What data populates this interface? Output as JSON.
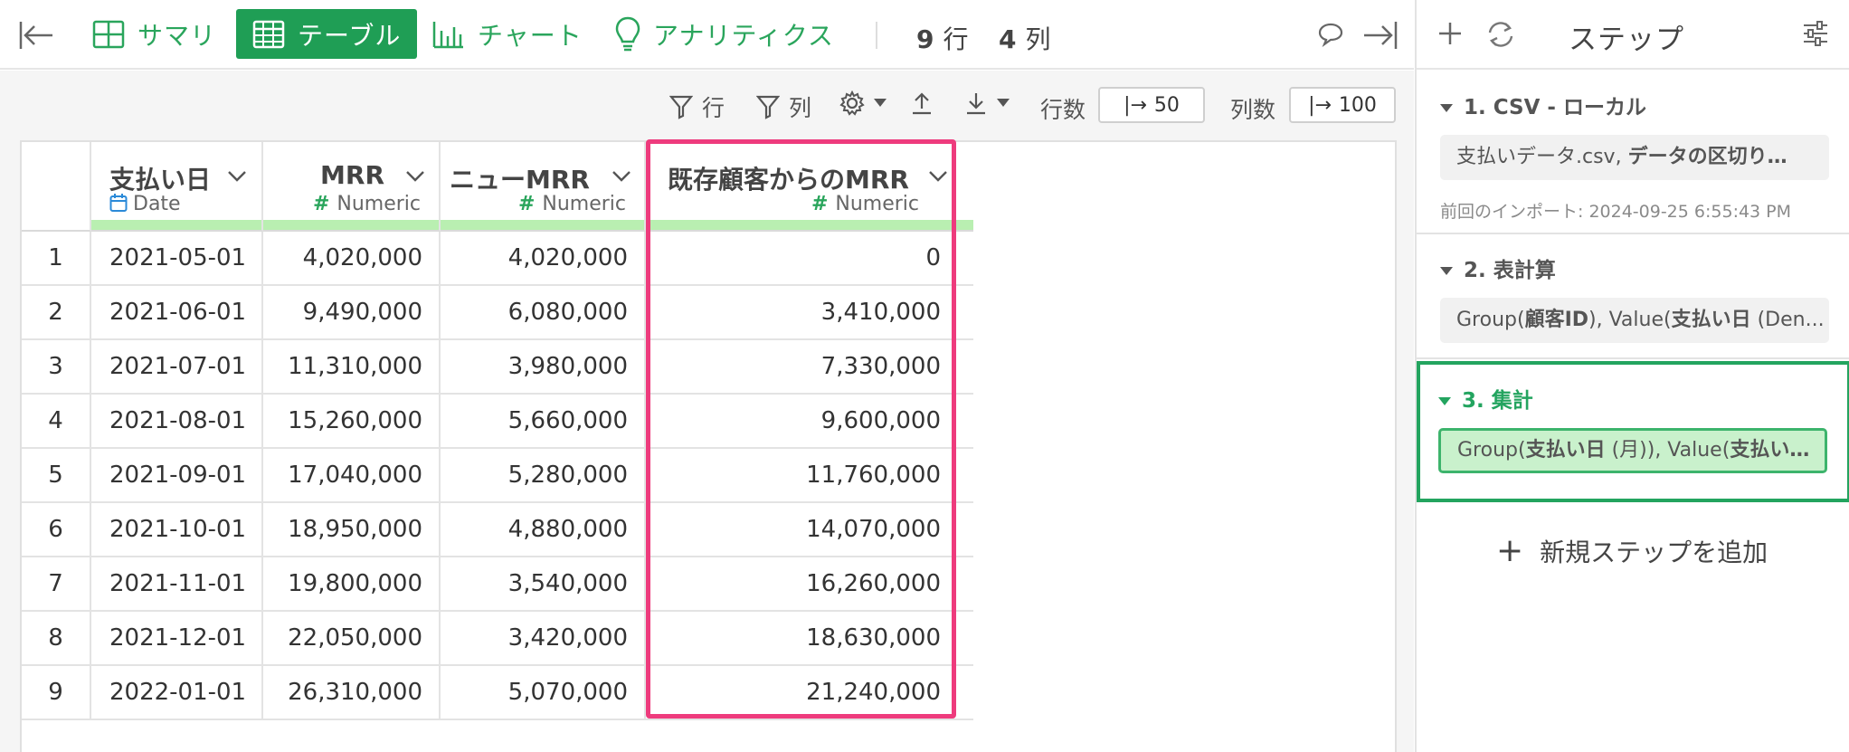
{
  "toolbar": {
    "tabs": [
      {
        "label": "サマリ",
        "icon": "summary-grid-icon"
      },
      {
        "label": "テーブル",
        "icon": "table-icon",
        "active": true
      },
      {
        "label": "チャート",
        "icon": "bar-chart-icon"
      },
      {
        "label": "アナリティクス",
        "icon": "lightbulb-icon"
      }
    ],
    "rows_count": "9",
    "rows_unit": "行",
    "cols_count": "4",
    "cols_unit": "列"
  },
  "subbar": {
    "row_filter": "行",
    "col_filter": "列",
    "row_count_label": "行数",
    "row_count_value": "50",
    "col_count_label": "列数",
    "col_count_value": "100"
  },
  "table": {
    "columns": [
      {
        "name": "支払い日",
        "type": "Date"
      },
      {
        "name": "MRR",
        "type": "Numeric"
      },
      {
        "name": "ニューMRR",
        "type": "Numeric"
      },
      {
        "name": "既存顧客からのMRR",
        "type": "Numeric"
      }
    ],
    "rows": [
      [
        "1",
        "2021-05-01",
        "4,020,000",
        "4,020,000",
        "0"
      ],
      [
        "2",
        "2021-06-01",
        "9,490,000",
        "6,080,000",
        "3,410,000"
      ],
      [
        "3",
        "2021-07-01",
        "11,310,000",
        "3,980,000",
        "7,330,000"
      ],
      [
        "4",
        "2021-08-01",
        "15,260,000",
        "5,660,000",
        "9,600,000"
      ],
      [
        "5",
        "2021-09-01",
        "17,040,000",
        "5,280,000",
        "11,760,000"
      ],
      [
        "6",
        "2021-10-01",
        "18,950,000",
        "4,880,000",
        "14,070,000"
      ],
      [
        "7",
        "2021-11-01",
        "19,800,000",
        "3,540,000",
        "16,260,000"
      ],
      [
        "8",
        "2021-12-01",
        "22,050,000",
        "3,420,000",
        "18,630,000"
      ],
      [
        "9",
        "2022-01-01",
        "26,310,000",
        "5,070,000",
        "21,240,000"
      ]
    ]
  },
  "panel": {
    "title": "ステップ",
    "steps": [
      {
        "title": "1. CSV - ローカル",
        "summary_plain": "支払いデータ.csv, ",
        "summary_bold": "データの区切り…",
        "meta": "前回のインポート: 2024-09-25 6:55:43 PM"
      },
      {
        "title": "2. 表計算",
        "s1": "Group(",
        "s2": "顧客ID",
        "s3": "), Value(",
        "s4": "支払い日",
        "s5": " (Den..."
      },
      {
        "title": "3. 集計",
        "s1": "Group(",
        "s2": "支払い日",
        "s3": " (月)), Value(",
        "s4": "支払い…"
      }
    ],
    "add_step": "新規ステップを追加"
  },
  "colors": {
    "accent_green": "#1f9e55",
    "highlight_pink": "#ee3b7d",
    "type_bar": "#b9efb1"
  }
}
